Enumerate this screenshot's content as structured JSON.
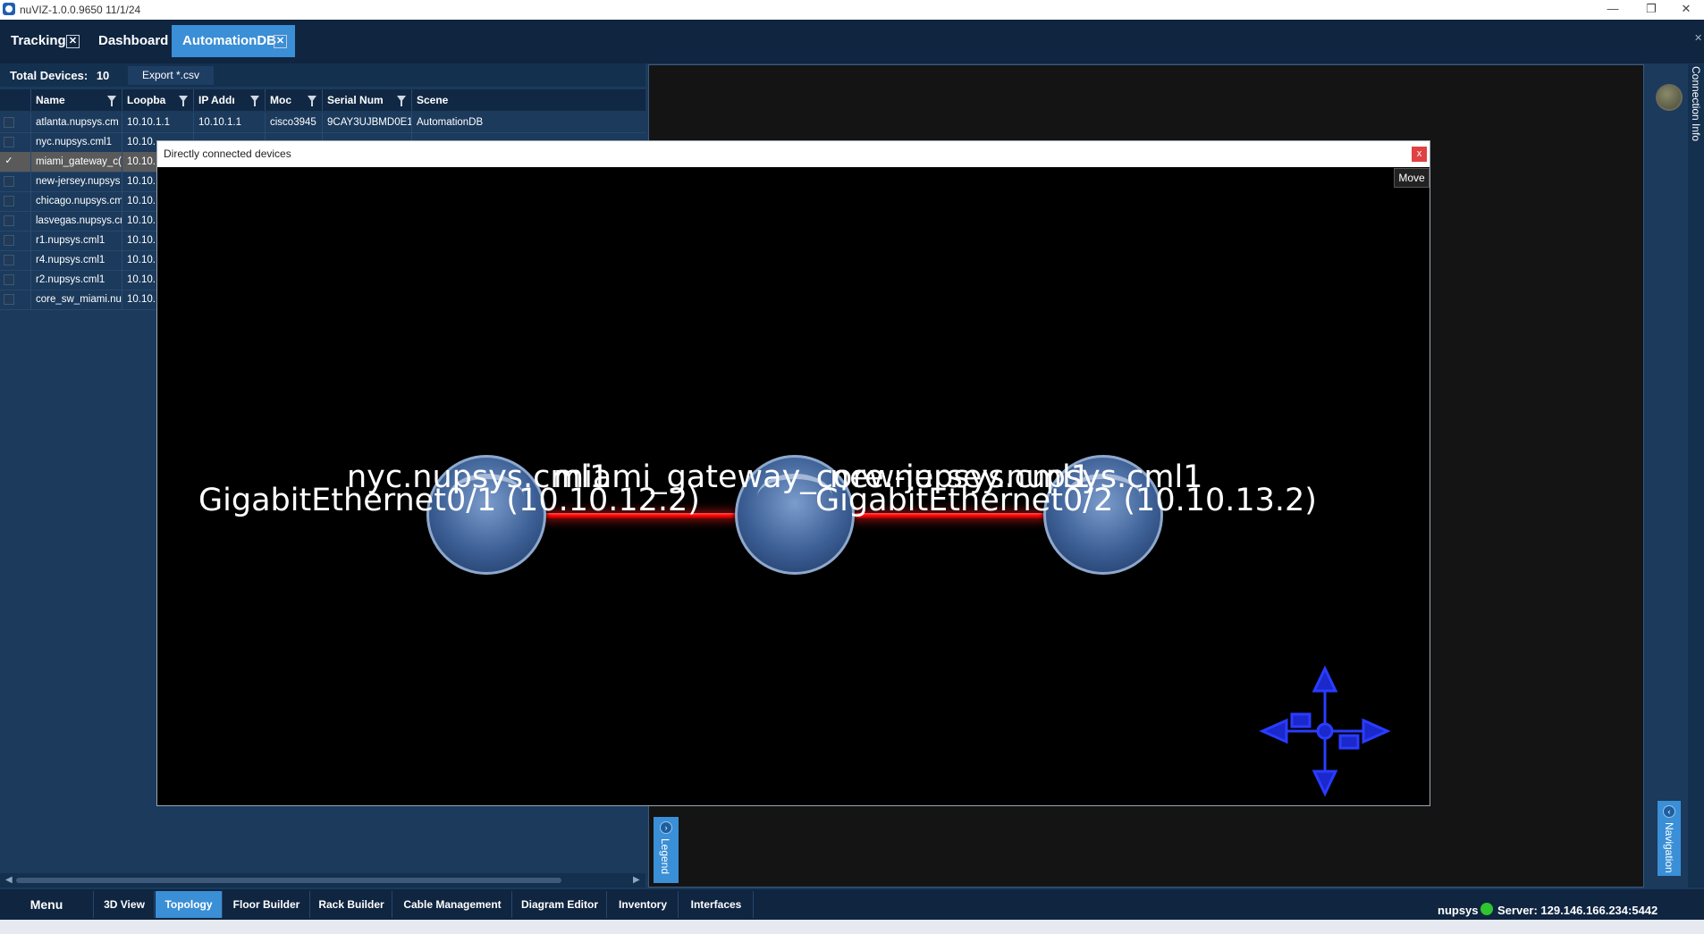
{
  "window": {
    "title": "nuVIZ-1.0.0.9650 11/1/24",
    "minimize": "—",
    "maximize": "❐",
    "close": "✕"
  },
  "tabs": [
    {
      "label": "Tracking",
      "closable": true
    },
    {
      "label": "Dashboard",
      "closable": false
    },
    {
      "label": "AutomationDB",
      "closable": true,
      "active": true
    }
  ],
  "devices": {
    "total_label": "Total Devices:",
    "total_value": "10",
    "export_label": "Export *.csv",
    "columns": [
      "Name",
      "Loopba",
      "IP Addı",
      "Moc",
      "Serial Num",
      "Scene"
    ],
    "rows": [
      {
        "checked": false,
        "name": "atlanta.nupsys.cm",
        "loopback": "10.10.1.1",
        "ip": "10.10.1.1",
        "model": "cisco3945",
        "serial": "9CAY3UJBMD0E1(",
        "scene": "AutomationDB"
      },
      {
        "checked": false,
        "name": "nyc.nupsys.cml1",
        "loopback": "10.10.",
        "ip": "",
        "model": "",
        "serial": "",
        "scene": ""
      },
      {
        "checked": true,
        "name": "miami_gateway_c(",
        "loopback": "10.10.",
        "ip": "",
        "model": "",
        "serial": "",
        "scene": ""
      },
      {
        "checked": false,
        "name": "new-jersey.nupsys",
        "loopback": "10.10.",
        "ip": "",
        "model": "",
        "serial": "",
        "scene": ""
      },
      {
        "checked": false,
        "name": "chicago.nupsys.cm",
        "loopback": "10.10.",
        "ip": "",
        "model": "",
        "serial": "",
        "scene": ""
      },
      {
        "checked": false,
        "name": "lasvegas.nupsys.cr",
        "loopback": "10.10.",
        "ip": "",
        "model": "",
        "serial": "",
        "scene": ""
      },
      {
        "checked": false,
        "name": "r1.nupsys.cml1",
        "loopback": "10.10.",
        "ip": "",
        "model": "",
        "serial": "",
        "scene": ""
      },
      {
        "checked": false,
        "name": "r4.nupsys.cml1",
        "loopback": "10.10.",
        "ip": "",
        "model": "",
        "serial": "",
        "scene": ""
      },
      {
        "checked": false,
        "name": "r2.nupsys.cml1",
        "loopback": "10.10.",
        "ip": "",
        "model": "",
        "serial": "",
        "scene": ""
      },
      {
        "checked": false,
        "name": "core_sw_miami.nu",
        "loopback": "10.10.",
        "ip": "",
        "model": "",
        "serial": "",
        "scene": ""
      }
    ]
  },
  "modal": {
    "title": "Directly connected devices",
    "close_label": "x",
    "move_label": "Move",
    "nodes": [
      {
        "label": "nyc.nupsys.cml1"
      },
      {
        "label": "miami_gateway_core.nupsys.cml1"
      },
      {
        "label": "new-jersey.nupsys.cml1"
      }
    ],
    "links": [
      {
        "label": "GigabitEthernet0/1 (10.10.12.2)"
      },
      {
        "label": "GigabitEthernet0/2 (10.10.13.2)"
      }
    ]
  },
  "side": {
    "connection_info": "Connection Info",
    "legend": "Legend",
    "navigation": "Navigation"
  },
  "bottom_tabs": [
    {
      "label": "Menu"
    },
    {
      "label": "3D View"
    },
    {
      "label": "Topology",
      "active": true
    },
    {
      "label": "Floor Builder"
    },
    {
      "label": "Rack Builder"
    },
    {
      "label": "Cable Management"
    },
    {
      "label": "Diagram Editor"
    },
    {
      "label": "Inventory"
    },
    {
      "label": "Interfaces"
    }
  ],
  "status": {
    "user": "nupsys",
    "server": "Server: 129.146.166.234:5442",
    "online_color": "#2ec52e"
  },
  "colors": {
    "accent": "#3a8fd6",
    "link": "#ff0000",
    "navigator": "#2a3cff"
  }
}
